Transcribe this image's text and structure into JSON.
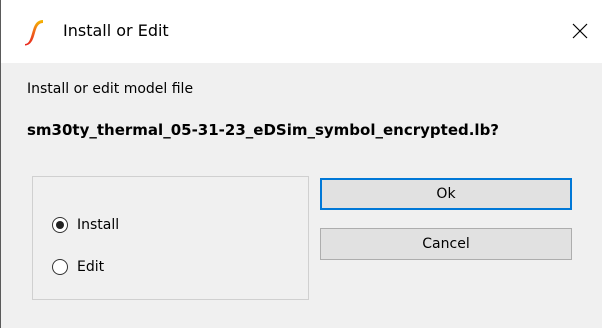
{
  "window": {
    "title": "Install or Edit",
    "close_label": "✕"
  },
  "dialog": {
    "prompt": "Install or edit model file",
    "filename": "sm30ty_thermal_05-31-23_eDSim_symbol_encrypted.lb?"
  },
  "options": {
    "install_label": "Install",
    "edit_label": "Edit",
    "selected": "Install"
  },
  "buttons": {
    "ok_label": "Ok",
    "cancel_label": "Cancel"
  },
  "colors": {
    "accent": "#0078d7",
    "logo_red": "#e8251f",
    "logo_yellow": "#f5b800"
  }
}
